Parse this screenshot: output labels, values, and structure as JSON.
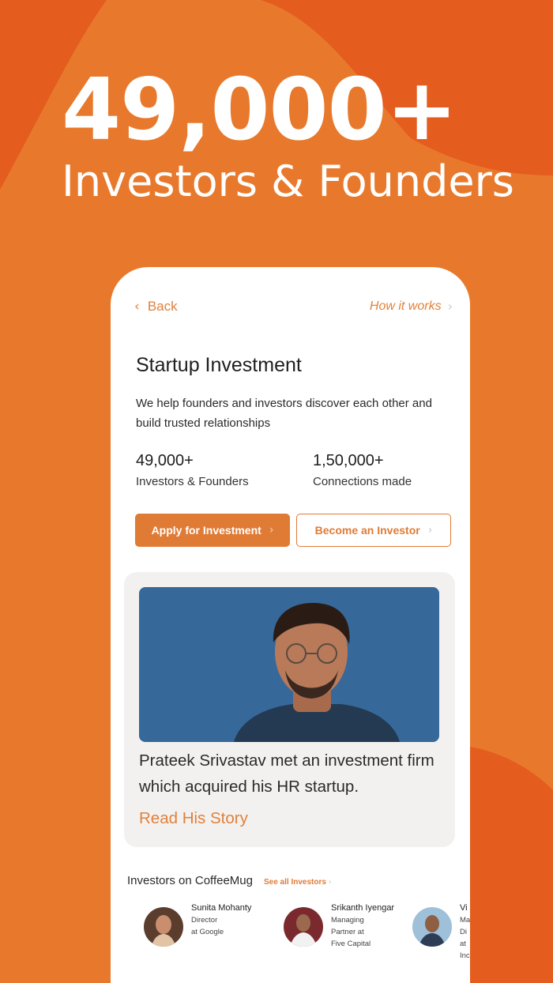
{
  "hero": {
    "number": "49,000+",
    "subtitle": "Investors & Founders"
  },
  "colors": {
    "brand_orange": "#e8792c",
    "accent_orange": "#e07b36",
    "photo_blue": "#36689a"
  },
  "nav": {
    "back_label": "Back",
    "back_icon": "chevron-left-icon",
    "how_label": "How it works",
    "how_icon": "chevron-right-icon"
  },
  "page": {
    "title": "Startup Investment",
    "description": "We help founders and investors discover each other and build trusted relationships"
  },
  "stats": [
    {
      "value": "49,000+",
      "label": "Investors & Founders"
    },
    {
      "value": "1,50,000+",
      "label": "Connections made"
    }
  ],
  "buttons": {
    "apply": "Apply for Investment",
    "become": "Become an Investor"
  },
  "story": {
    "text": "Prateek Srivastav met an investment firm which acquired his HR startup.",
    "link": "Read His Story"
  },
  "investors_section": {
    "title": "Investors on CoffeeMug",
    "see_all": "See all Investors",
    "items": [
      {
        "name": "Sunita Mohanty",
        "lines": [
          "Director",
          "at Google"
        ]
      },
      {
        "name": "Srikanth Iyengar",
        "lines": [
          "Managing",
          "Partner at",
          "Five Capital"
        ]
      },
      {
        "name": "Vi",
        "lines": [
          "Ma",
          "Di",
          "at",
          "Inc"
        ]
      }
    ]
  }
}
